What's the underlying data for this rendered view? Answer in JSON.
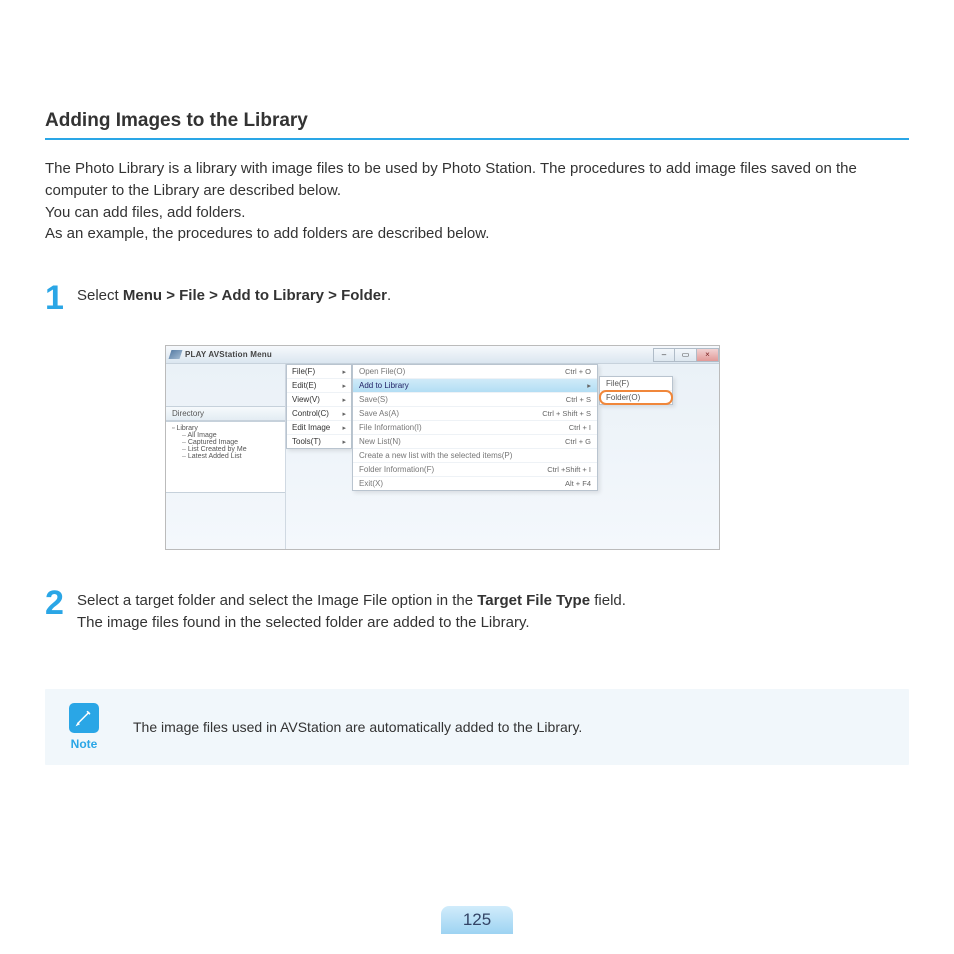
{
  "section_title": "Adding Images to the Library",
  "intro": {
    "p1": "The Photo Library is a library with image files to be used by Photo Station. The procedures to add image files saved on the computer to the Library are described below.",
    "p2": "You can add files, add folders.",
    "p3": "As an example, the procedures to add folders are described below."
  },
  "step1": {
    "num": "1",
    "prefix": "Select ",
    "bold": "Menu > File > Add to Library > Folder",
    "suffix": "."
  },
  "step2": {
    "num": "2",
    "line1_prefix": "Select a target folder and select the Image File option in the ",
    "line1_bold": "Target File Type",
    "line1_suffix": " field.",
    "line2": "The image files found in the selected folder are added to the Library."
  },
  "note": {
    "label": "Note",
    "text": "The image files used in AVStation are automatically added to the Library."
  },
  "page_number": "125",
  "screenshot": {
    "title": "PLAY AVStation  Menu",
    "win_buttons": {
      "min": "–",
      "max": "▭",
      "close": "×"
    },
    "directory_label": "Directory",
    "tree_root": "Library",
    "tree_items": [
      "All Image",
      "Captured Image",
      "List Created by Me",
      "Latest Added List"
    ],
    "menubar": [
      {
        "label": "File(F)",
        "arrow": true
      },
      {
        "label": "Edit(E)",
        "arrow": true
      },
      {
        "label": "View(V)",
        "arrow": true
      },
      {
        "label": "Control(C)",
        "arrow": true
      },
      {
        "label": "Edit Image",
        "arrow": true
      },
      {
        "label": "Tools(T)",
        "arrow": true
      }
    ],
    "submenu1": [
      {
        "label": "Open File(O)",
        "kbd": "Ctrl + O"
      },
      {
        "label": "Add to Library",
        "kbd": "▸",
        "highlight": true
      },
      {
        "label": "Save(S)",
        "kbd": "Ctrl + S"
      },
      {
        "label": "Save As(A)",
        "kbd": "Ctrl + Shift + S"
      },
      {
        "label": "File Information(I)",
        "kbd": "Ctrl + I"
      },
      {
        "label": "New List(N)",
        "kbd": "Ctrl + G"
      },
      {
        "label": "Create a new list with the selected items(P)",
        "kbd": ""
      },
      {
        "label": "Folder Information(F)",
        "kbd": "Ctrl +Shift + I"
      },
      {
        "label": "Exit(X)",
        "kbd": "Alt + F4"
      }
    ],
    "submenu2": [
      {
        "label": "File(F)",
        "boxed": false
      },
      {
        "label": "Folder(O)",
        "boxed": true
      }
    ]
  }
}
